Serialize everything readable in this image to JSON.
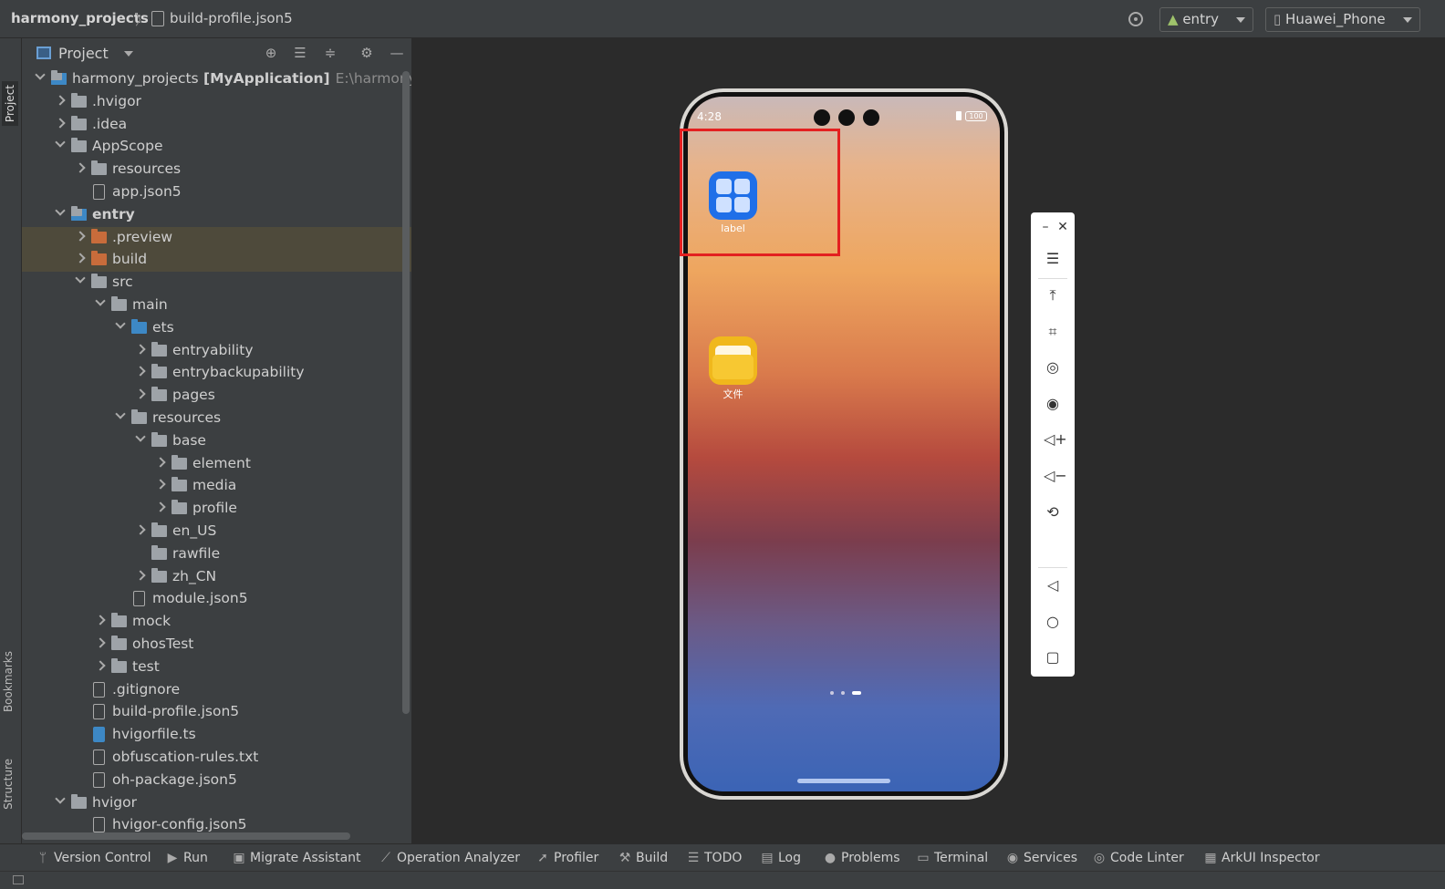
{
  "titlebar": {
    "project": "harmony_projects",
    "separator": "〉",
    "file": "build-profile.json5",
    "module_select": "entry",
    "device_select": "Huawei_Phone"
  },
  "left_strip": {
    "project_tab": "Project",
    "bookmarks_tab": "Bookmarks",
    "structure_tab": "Structure"
  },
  "panel": {
    "title": "Project"
  },
  "tree": [
    {
      "indent": 0,
      "exp": "e",
      "icon": "module",
      "name": "harmony_projects",
      "bold": "[MyApplication]",
      "path": "E:\\harmony_pro"
    },
    {
      "indent": 1,
      "exp": "c",
      "icon": "folder",
      "name": ".hvigor"
    },
    {
      "indent": 1,
      "exp": "c",
      "icon": "folder",
      "name": ".idea"
    },
    {
      "indent": 1,
      "exp": "e",
      "icon": "folder",
      "name": "AppScope"
    },
    {
      "indent": 2,
      "exp": "c",
      "icon": "folder",
      "name": "resources"
    },
    {
      "indent": 2,
      "exp": "",
      "icon": "file",
      "name": "app.json5"
    },
    {
      "indent": 1,
      "exp": "e",
      "icon": "module",
      "name": "entry",
      "namebold": true
    },
    {
      "indent": 2,
      "exp": "c",
      "icon": "orange",
      "name": ".preview",
      "hl": true
    },
    {
      "indent": 2,
      "exp": "c",
      "icon": "orange",
      "name": "build",
      "hl": true
    },
    {
      "indent": 2,
      "exp": "e",
      "icon": "folder",
      "name": "src"
    },
    {
      "indent": 3,
      "exp": "e",
      "icon": "folder",
      "name": "main"
    },
    {
      "indent": 4,
      "exp": "e",
      "icon": "blue",
      "name": "ets"
    },
    {
      "indent": 5,
      "exp": "c",
      "icon": "folder",
      "name": "entryability"
    },
    {
      "indent": 5,
      "exp": "c",
      "icon": "folder",
      "name": "entrybackupability"
    },
    {
      "indent": 5,
      "exp": "c",
      "icon": "folder",
      "name": "pages"
    },
    {
      "indent": 4,
      "exp": "e",
      "icon": "folder",
      "name": "resources"
    },
    {
      "indent": 5,
      "exp": "e",
      "icon": "folder",
      "name": "base"
    },
    {
      "indent": 6,
      "exp": "c",
      "icon": "folder",
      "name": "element"
    },
    {
      "indent": 6,
      "exp": "c",
      "icon": "folder",
      "name": "media"
    },
    {
      "indent": 6,
      "exp": "c",
      "icon": "folder",
      "name": "profile"
    },
    {
      "indent": 5,
      "exp": "c",
      "icon": "folder",
      "name": "en_US"
    },
    {
      "indent": 5,
      "exp": "",
      "icon": "folder",
      "name": "rawfile"
    },
    {
      "indent": 5,
      "exp": "c",
      "icon": "folder",
      "name": "zh_CN"
    },
    {
      "indent": 4,
      "exp": "",
      "icon": "file",
      "name": "module.json5"
    },
    {
      "indent": 3,
      "exp": "c",
      "icon": "folder",
      "name": "mock"
    },
    {
      "indent": 3,
      "exp": "c",
      "icon": "folder",
      "name": "ohosTest"
    },
    {
      "indent": 3,
      "exp": "c",
      "icon": "folder",
      "name": "test"
    },
    {
      "indent": 2,
      "exp": "",
      "icon": "file",
      "name": ".gitignore"
    },
    {
      "indent": 2,
      "exp": "",
      "icon": "file",
      "name": "build-profile.json5"
    },
    {
      "indent": 2,
      "exp": "",
      "icon": "ts",
      "name": "hvigorfile.ts"
    },
    {
      "indent": 2,
      "exp": "",
      "icon": "file",
      "name": "obfuscation-rules.txt"
    },
    {
      "indent": 2,
      "exp": "",
      "icon": "file",
      "name": "oh-package.json5"
    },
    {
      "indent": 1,
      "exp": "e",
      "icon": "folder",
      "name": "hvigor"
    },
    {
      "indent": 2,
      "exp": "",
      "icon": "file",
      "name": "hvigor-config.json5"
    }
  ],
  "phone": {
    "time": "4:28",
    "battery": "100",
    "app1_label": "label",
    "app2_label": "文件"
  },
  "bottom_tools": [
    {
      "icon": "branch-icon",
      "glyph": "ᛘ",
      "label": "Version Control"
    },
    {
      "icon": "run-icon",
      "glyph": "▶",
      "label": "Run"
    },
    {
      "icon": "migrate-icon",
      "glyph": "▣",
      "label": "Migrate Assistant"
    },
    {
      "icon": "chart-icon",
      "glyph": "⟋",
      "label": "Operation Analyzer"
    },
    {
      "icon": "profiler-icon",
      "glyph": "➚",
      "label": "Profiler"
    },
    {
      "icon": "hammer-icon",
      "glyph": "⚒",
      "label": "Build"
    },
    {
      "icon": "list-icon",
      "glyph": "☰",
      "label": "TODO"
    },
    {
      "icon": "log-icon",
      "glyph": "▤",
      "label": "Log"
    },
    {
      "icon": "problems-icon",
      "glyph": "●",
      "label": "Problems"
    },
    {
      "icon": "terminal-icon",
      "glyph": "▭",
      "label": "Terminal"
    },
    {
      "icon": "services-icon",
      "glyph": "◉",
      "label": "Services"
    },
    {
      "icon": "linter-icon",
      "glyph": "◎",
      "label": "Code Linter"
    },
    {
      "icon": "inspector-icon",
      "glyph": "▦",
      "label": "ArkUI Inspector"
    }
  ]
}
